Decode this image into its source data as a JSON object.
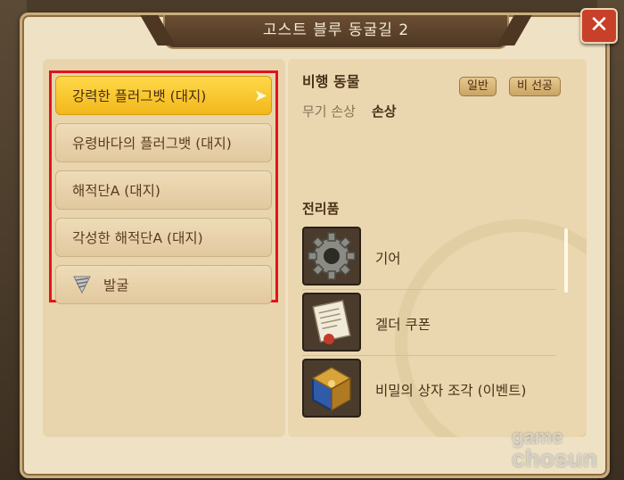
{
  "window": {
    "title": "고스트 블루 동굴길 2",
    "close_icon": "close-icon"
  },
  "list": {
    "items": [
      {
        "label": "강력한 플러그뱃 (대지)",
        "selected": true
      },
      {
        "label": "유령바다의 플러그뱃 (대지)",
        "selected": false
      },
      {
        "label": "해적단A (대지)",
        "selected": false
      },
      {
        "label": "각성한 해적단A (대지)",
        "selected": false
      },
      {
        "label": "발굴",
        "selected": false,
        "icon": "drill-icon"
      }
    ],
    "highlight_color": "#e0141c"
  },
  "detail": {
    "name": "비행 동물",
    "badges": [
      "일반",
      "비 선공"
    ],
    "stat_label": "무기 손상",
    "stat_value": "손상",
    "loot_title": "전리품",
    "loot": [
      {
        "label": "기어",
        "icon": "gear-icon"
      },
      {
        "label": "겔더 쿠폰",
        "icon": "scroll-icon"
      },
      {
        "label": "비밀의 상자 조각 (이벤트)",
        "icon": "chest-piece-icon"
      }
    ]
  },
  "watermark": {
    "line1": "game",
    "line2": "chosun"
  }
}
